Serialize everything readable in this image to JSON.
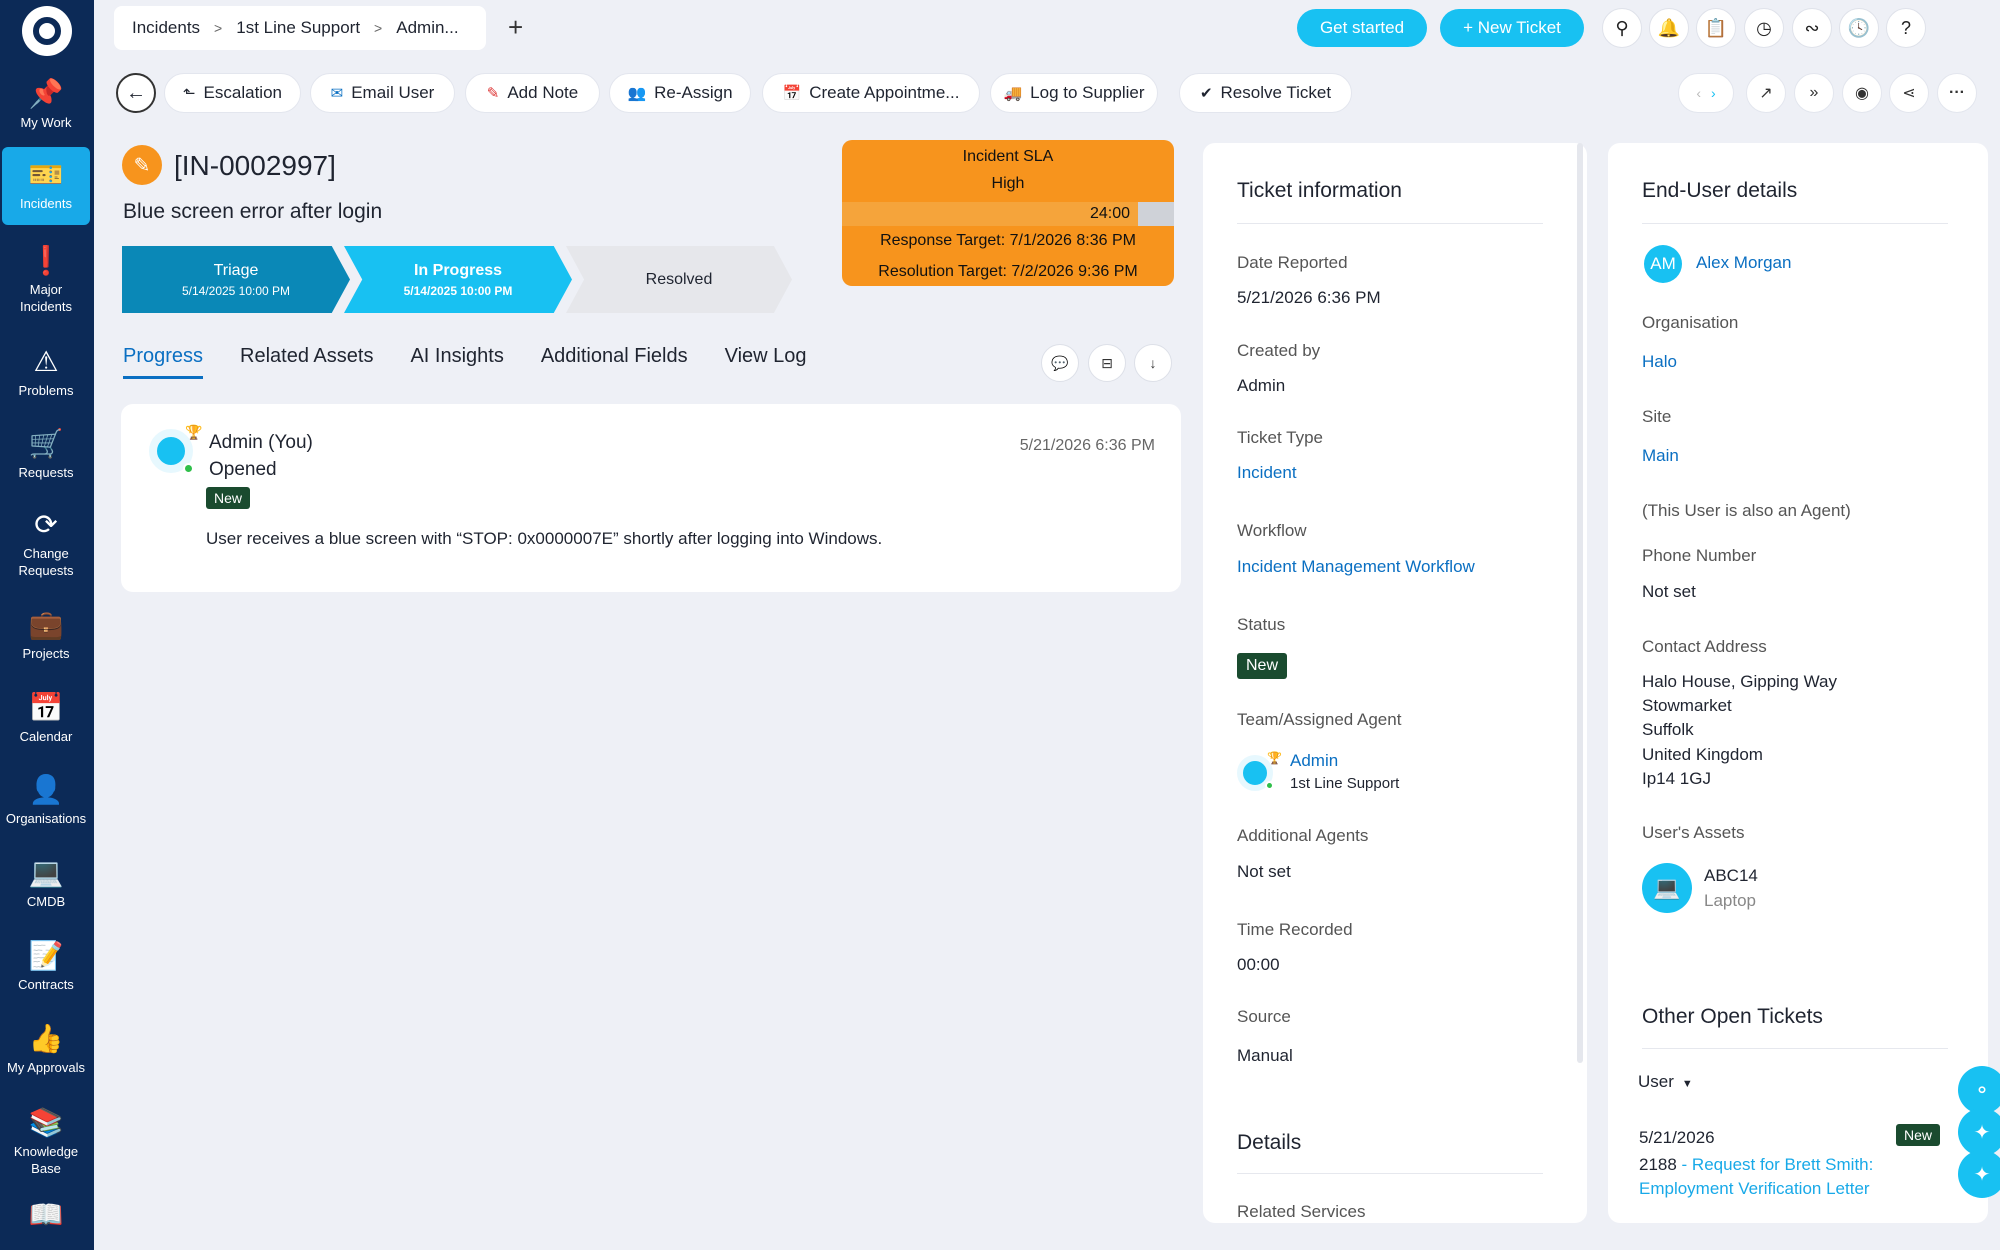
{
  "sidebar": {
    "items": [
      {
        "label": "My Work",
        "icon": "📌"
      },
      {
        "label": "Incidents",
        "icon": "🎫"
      },
      {
        "label": "Major Incidents",
        "icon": "❗"
      },
      {
        "label": "Problems",
        "icon": "⚠"
      },
      {
        "label": "Requests",
        "icon": "🛒"
      },
      {
        "label": "Change Requests",
        "icon": "⟳"
      },
      {
        "label": "Projects",
        "icon": "💼"
      },
      {
        "label": "Calendar",
        "icon": "📅"
      },
      {
        "label": "Organisations",
        "icon": "👤"
      },
      {
        "label": "CMDB",
        "icon": "💻"
      },
      {
        "label": "Contracts",
        "icon": "📝"
      },
      {
        "label": "My Approvals",
        "icon": "👍"
      },
      {
        "label": "Knowledge Base",
        "icon": "📚"
      },
      {
        "label": "",
        "icon": "📖"
      }
    ]
  },
  "topbar": {
    "breadcrumb": [
      "Incidents",
      "1st Line Support",
      "Admin..."
    ],
    "add_tab": "+",
    "get_started": "Get started",
    "new_ticket": "+ New Ticket"
  },
  "actions": {
    "escalation": "Escalation",
    "email_user": "Email User",
    "add_note": "Add Note",
    "reassign": "Re-Assign",
    "create_appointment": "Create Appointme...",
    "log_to_supplier": "Log to Supplier",
    "resolve_ticket": "Resolve Ticket"
  },
  "ticket": {
    "id": "[IN-0002997]",
    "summary": "Blue screen error after login",
    "stages": [
      {
        "name": "Triage",
        "date": "5/14/2025 10:00 PM"
      },
      {
        "name": "In Progress",
        "date": "5/14/2025 10:00 PM"
      },
      {
        "name": "Resolved",
        "date": ""
      }
    ]
  },
  "sla": {
    "title": "Incident SLA",
    "priority": "High",
    "time": "24:00",
    "response_target": "Response Target: 7/1/2026 8:36 PM",
    "resolution_target": "Resolution Target: 7/2/2026 9:36 PM"
  },
  "tabs": [
    "Progress",
    "Related Assets",
    "AI Insights",
    "Additional Fields",
    "View Log"
  ],
  "progress": {
    "author": "Admin (You)",
    "action": "Opened",
    "status": "New",
    "date": "5/21/2026 6:36 PM",
    "body": "User receives a blue screen with “STOP: 0x0000007E” shortly after logging into Windows."
  },
  "ticket_info": {
    "title": "Ticket information",
    "date_reported_label": "Date Reported",
    "date_reported": "5/21/2026 6:36 PM",
    "created_by_label": "Created by",
    "created_by": "Admin",
    "ticket_type_label": "Ticket Type",
    "ticket_type": "Incident",
    "workflow_label": "Workflow",
    "workflow": "Incident Management Workflow",
    "status_label": "Status",
    "status": "New",
    "team_label": "Team/Assigned Agent",
    "agent": "Admin",
    "team": "1st Line Support",
    "additional_agents_label": "Additional Agents",
    "additional_agents": "Not set",
    "time_recorded_label": "Time Recorded",
    "time_recorded": "00:00",
    "source_label": "Source",
    "source": "Manual",
    "details_title": "Details",
    "related_services_label": "Related Services"
  },
  "end_user": {
    "title": "End-User details",
    "initials": "AM",
    "name": "Alex Morgan",
    "organisation_label": "Organisation",
    "organisation": "Halo",
    "site_label": "Site",
    "site": "Main",
    "agent_note": "(This User is also an Agent)",
    "phone_label": "Phone Number",
    "phone": "Not set",
    "address_label": "Contact Address",
    "address": [
      "Halo House, Gipping Way",
      "Stowmarket",
      "Suffolk",
      "United Kingdom",
      "Ip14 1GJ"
    ],
    "assets_label": "User's Assets",
    "asset_name": "ABC14",
    "asset_type": "Laptop",
    "other_tickets_title": "Other Open Tickets",
    "filter": "User",
    "other_ticket": {
      "date": "5/21/2026",
      "number": "2188",
      "title": " - Request for Brett Smith: Employment Verification Letter",
      "status": "New"
    }
  },
  "colors": {
    "sidebar": "#0c2a57",
    "accent": "#18c1f2",
    "sla": "#f7941d",
    "status_new": "#1a4b2f",
    "link": "#0a6fc2"
  }
}
